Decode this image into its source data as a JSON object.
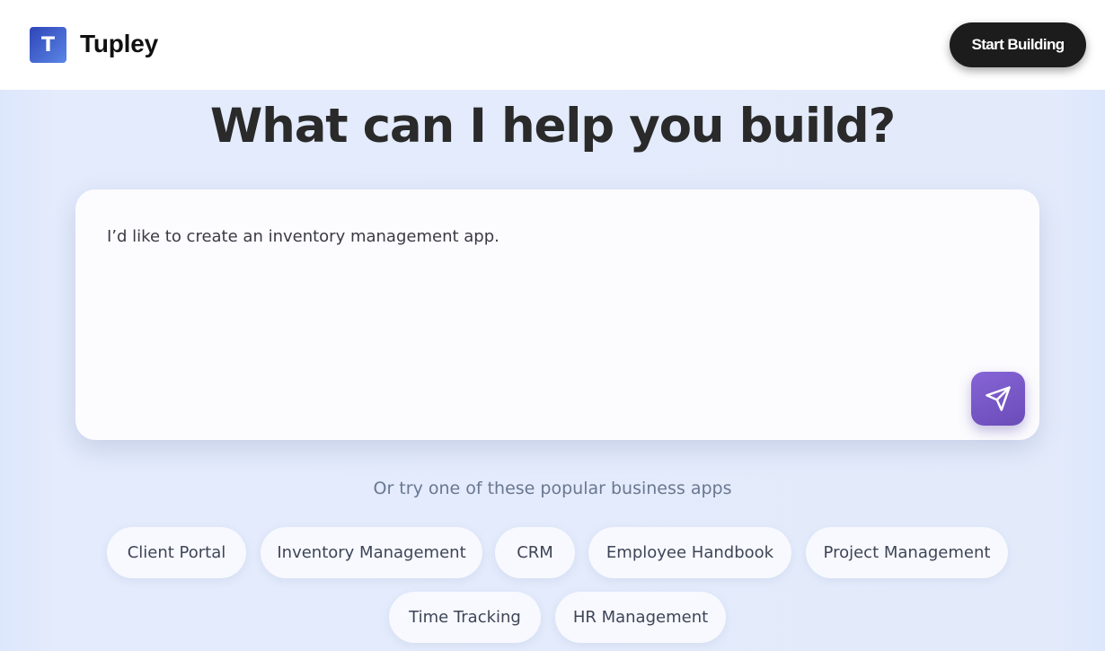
{
  "header": {
    "logo_letter": "T",
    "brand_name": "Tupley",
    "cta_label": "Start Building"
  },
  "hero": {
    "title": "What can I help you build?"
  },
  "prompt": {
    "value": "I’d like to create an inventory management app.",
    "send_icon": "send-icon"
  },
  "suggestions": {
    "caption": "Or try one of these popular business apps",
    "chips": [
      "Client Portal",
      "Inventory Management",
      "CRM",
      "Employee Handbook",
      "Project Management",
      "Time Tracking",
      "HR Management"
    ]
  },
  "colors": {
    "accent_purple": "#7457c6",
    "logo_blue": "#3b5bd0",
    "page_background": "#e1e9fb",
    "cta_background": "#1c1c1c"
  }
}
